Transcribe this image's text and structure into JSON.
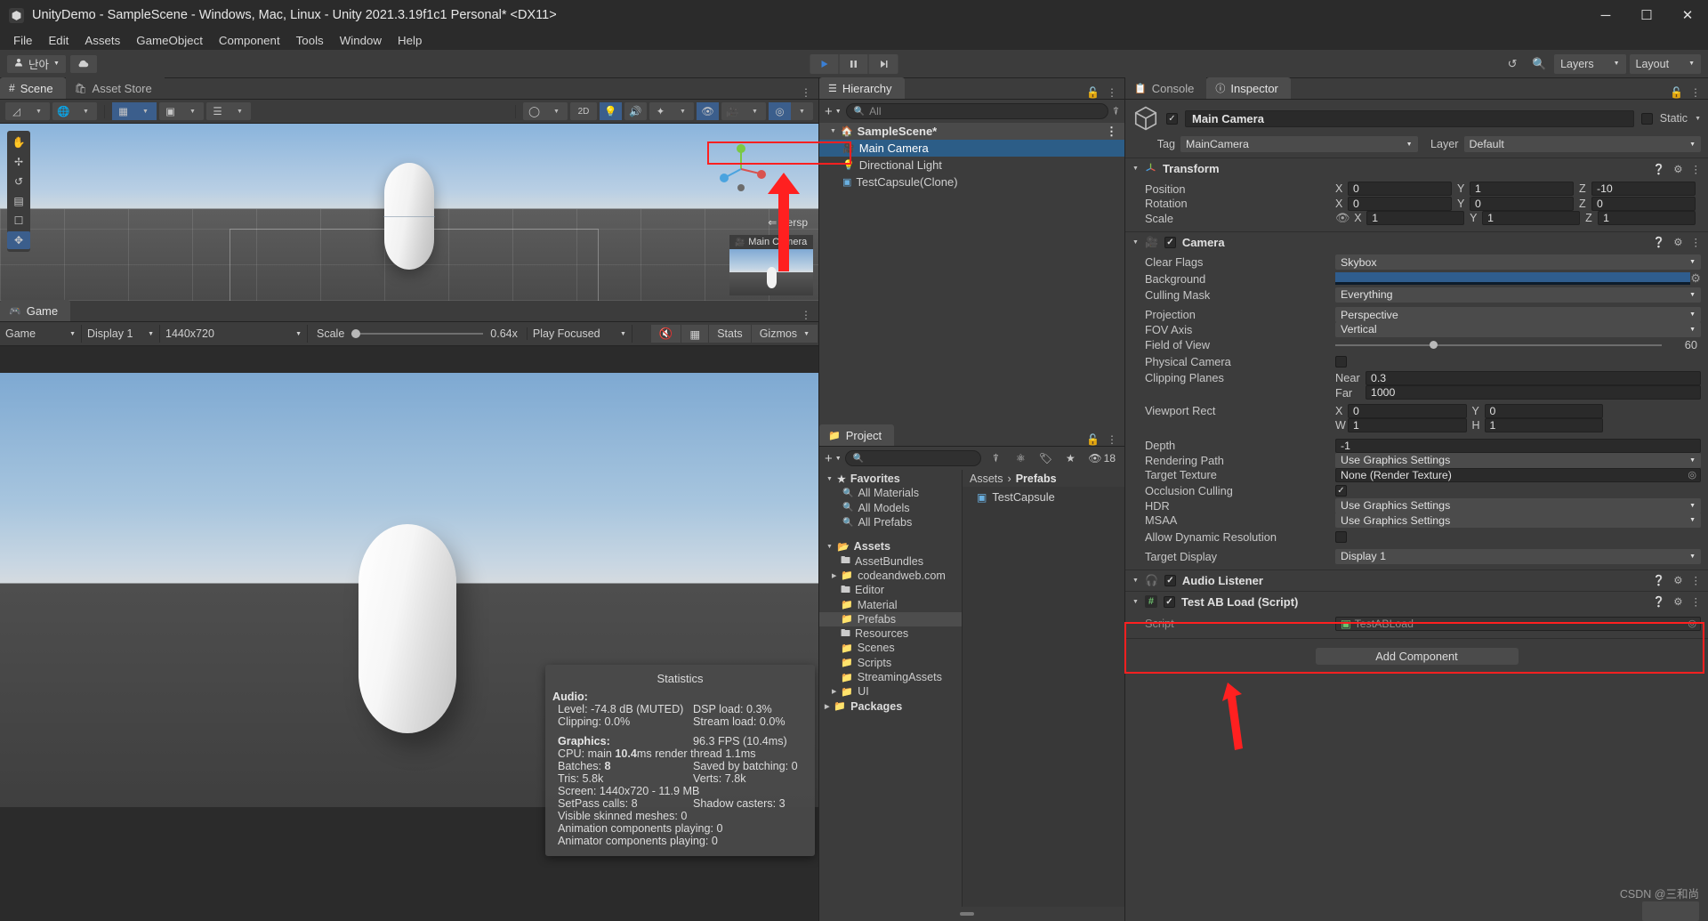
{
  "window": {
    "title": "UnityDemo - SampleScene - Windows, Mac, Linux - Unity 2021.3.19f1c1 Personal* <DX11>",
    "minimize": "─",
    "maximize": "☐",
    "close": "✕"
  },
  "menu": {
    "items": [
      "File",
      "Edit",
      "Assets",
      "GameObject",
      "Component",
      "Tools",
      "Window",
      "Help"
    ]
  },
  "toolbar": {
    "account": "난아",
    "play": "▶",
    "pause": "⏸",
    "step": "⏭",
    "undo_icon": "history-icon",
    "search_icon": "search-icon",
    "layers": "Layers",
    "layout": "Layout"
  },
  "scene": {
    "tabs": [
      {
        "label": "Scene",
        "icon": "scene-grid-icon",
        "active": true
      },
      {
        "label": "Asset Store",
        "icon": "store-icon",
        "active": false
      }
    ],
    "persp_label": "⇐ Persp",
    "camera_preview_label": "Main Camera",
    "tool_icons": [
      "hand-icon",
      "move-icon",
      "rotate-icon",
      "scale-icon",
      "rect-icon",
      "transform-icon"
    ],
    "toolbar_right": [
      "shaded-mode",
      "2D",
      "lighting-icon",
      "audio-icon",
      "fx-icon",
      "hidden-icon",
      "camera-icon",
      "gizmos-icon"
    ],
    "shading_label": "2D"
  },
  "game": {
    "tab_label": "Game",
    "aspect_dd": "Game",
    "display_dd": "Display 1",
    "resolution_dd": "1440x720",
    "scale_label": "Scale",
    "scale_value": "0.64x",
    "play_mode_dd": "Play Focused",
    "mute_icon": "mute-audio-icon",
    "grid_icon": "grid-icon",
    "stats_btn": "Stats",
    "gizmos_btn": "Gizmos"
  },
  "statistics": {
    "title": "Statistics",
    "audio_header": "Audio:",
    "audio_rows": [
      {
        "left": "Level: -74.8 dB (MUTED)",
        "right": "DSP load: 0.3%"
      },
      {
        "left": "Clipping: 0.0%",
        "right": "Stream load: 0.0%"
      }
    ],
    "graphics_header": "Graphics:",
    "fps": "96.3 FPS (10.4ms)",
    "cpu_pre": "CPU: main ",
    "cpu_bold": "10.4",
    "cpu_post": "ms  render thread 1.1ms",
    "batches_pre": "Batches: ",
    "batches_bold": "8",
    "saved_batching": "Saved by batching: 0",
    "tris": "Tris: 5.8k",
    "verts": "Verts: 7.8k",
    "screen": "Screen: 1440x720 - 11.9 MB",
    "setpass": "SetPass calls: 8",
    "shadow_casters": "Shadow casters: 3",
    "skinned": "Visible skinned meshes: 0",
    "anim_components": "Animation components playing: 0",
    "animator_components": "Animator components playing: 0"
  },
  "hierarchy": {
    "tab_label": "Hierarchy",
    "add_label": "+",
    "search_placeholder": "All",
    "scene_name": "SampleScene*",
    "items": [
      {
        "label": "Main Camera",
        "icon": "camera-icon",
        "selected": true,
        "indent": 1
      },
      {
        "label": "Directional Light",
        "icon": "light-icon",
        "selected": false,
        "indent": 1
      },
      {
        "label": "TestCapsule(Clone)",
        "icon": "prefab-icon",
        "selected": false,
        "indent": 1,
        "highlighted": true
      }
    ]
  },
  "project": {
    "tab_label": "Project",
    "search_placeholder": "",
    "hidden_count": "18",
    "favorites_label": "Favorites",
    "favorites": [
      "All Materials",
      "All Models",
      "All Prefabs"
    ],
    "assets_label": "Assets",
    "folders": [
      {
        "label": "AssetBundles",
        "expandable": false,
        "open": false,
        "selected": false
      },
      {
        "label": "codeandweb.com",
        "expandable": true,
        "open": false,
        "selected": false
      },
      {
        "label": "Editor",
        "expandable": false,
        "open": false,
        "selected": false
      },
      {
        "label": "Material",
        "expandable": false,
        "open": false,
        "selected": false
      },
      {
        "label": "Prefabs",
        "expandable": false,
        "open": false,
        "selected": true
      },
      {
        "label": "Resources",
        "expandable": false,
        "open": false,
        "selected": false
      },
      {
        "label": "Scenes",
        "expandable": false,
        "open": false,
        "selected": false
      },
      {
        "label": "Scripts",
        "expandable": false,
        "open": false,
        "selected": false
      },
      {
        "label": "StreamingAssets",
        "expandable": false,
        "open": false,
        "selected": false
      },
      {
        "label": "UI",
        "expandable": true,
        "open": false,
        "selected": false
      }
    ],
    "packages_label": "Packages",
    "breadcrumb_root": "Assets",
    "breadcrumb_sep": "›",
    "breadcrumb_current": "Prefabs",
    "items": [
      {
        "label": "TestCapsule",
        "icon": "prefab-cube-icon"
      }
    ]
  },
  "inspector": {
    "tabs": [
      {
        "label": "Console",
        "icon": "console-icon",
        "active": false
      },
      {
        "label": "Inspector",
        "icon": "info-icon",
        "active": true
      }
    ],
    "object_name": "Main Camera",
    "static_label": "Static",
    "tag_label": "Tag",
    "tag_value": "MainCamera",
    "layer_label": "Layer",
    "layer_value": "Default",
    "transform": {
      "title": "Transform",
      "rows": [
        {
          "label": "Position",
          "x": "0",
          "y": "1",
          "z": "-10"
        },
        {
          "label": "Rotation",
          "x": "0",
          "y": "0",
          "z": "0"
        },
        {
          "label": "Scale",
          "x": "1",
          "y": "1",
          "z": "1",
          "link_icon": "constrain-proportions-icon"
        }
      ]
    },
    "camera": {
      "title": "Camera",
      "clear_flags_label": "Clear Flags",
      "clear_flags_value": "Skybox",
      "background_label": "Background",
      "background_color": "#2f5d8e",
      "culling_mask_label": "Culling Mask",
      "culling_mask_value": "Everything",
      "projection_label": "Projection",
      "projection_value": "Perspective",
      "fov_axis_label": "FOV Axis",
      "fov_axis_value": "Vertical",
      "fov_label": "Field of View",
      "fov_value": "60",
      "physical_camera_label": "Physical Camera",
      "physical_camera_checked": false,
      "clipping_label": "Clipping Planes",
      "near_label": "Near",
      "near_value": "0.3",
      "far_label": "Far",
      "far_value": "1000",
      "viewport_label": "Viewport Rect",
      "vp_x_label": "X",
      "vp_x": "0",
      "vp_y_label": "Y",
      "vp_y": "0",
      "vp_w_label": "W",
      "vp_w": "1",
      "vp_h_label": "H",
      "vp_h": "1",
      "depth_label": "Depth",
      "depth_value": "-1",
      "rendering_path_label": "Rendering Path",
      "rendering_path_value": "Use Graphics Settings",
      "target_texture_label": "Target Texture",
      "target_texture_value": "None (Render Texture)",
      "occlusion_label": "Occlusion Culling",
      "occlusion_checked": true,
      "hdr_label": "HDR",
      "hdr_value": "Use Graphics Settings",
      "msaa_label": "MSAA",
      "msaa_value": "Use Graphics Settings",
      "dynres_label": "Allow Dynamic Resolution",
      "dynres_checked": false,
      "target_display_label": "Target Display",
      "target_display_value": "Display 1"
    },
    "audio_listener": {
      "title": "Audio Listener"
    },
    "script_component": {
      "title": "Test AB Load (Script)",
      "script_label": "Script",
      "script_value": "TestABLoad"
    },
    "add_component": "Add Component"
  },
  "watermark": {
    "text": "CSDN @三和尚"
  },
  "colors": {
    "accent_blue": "#3b5e8c",
    "selection_blue": "#2c5d87",
    "annotation_red": "#ff2020",
    "panel_bg": "#3c3c3c",
    "dark_bg": "#2b2b2b"
  }
}
